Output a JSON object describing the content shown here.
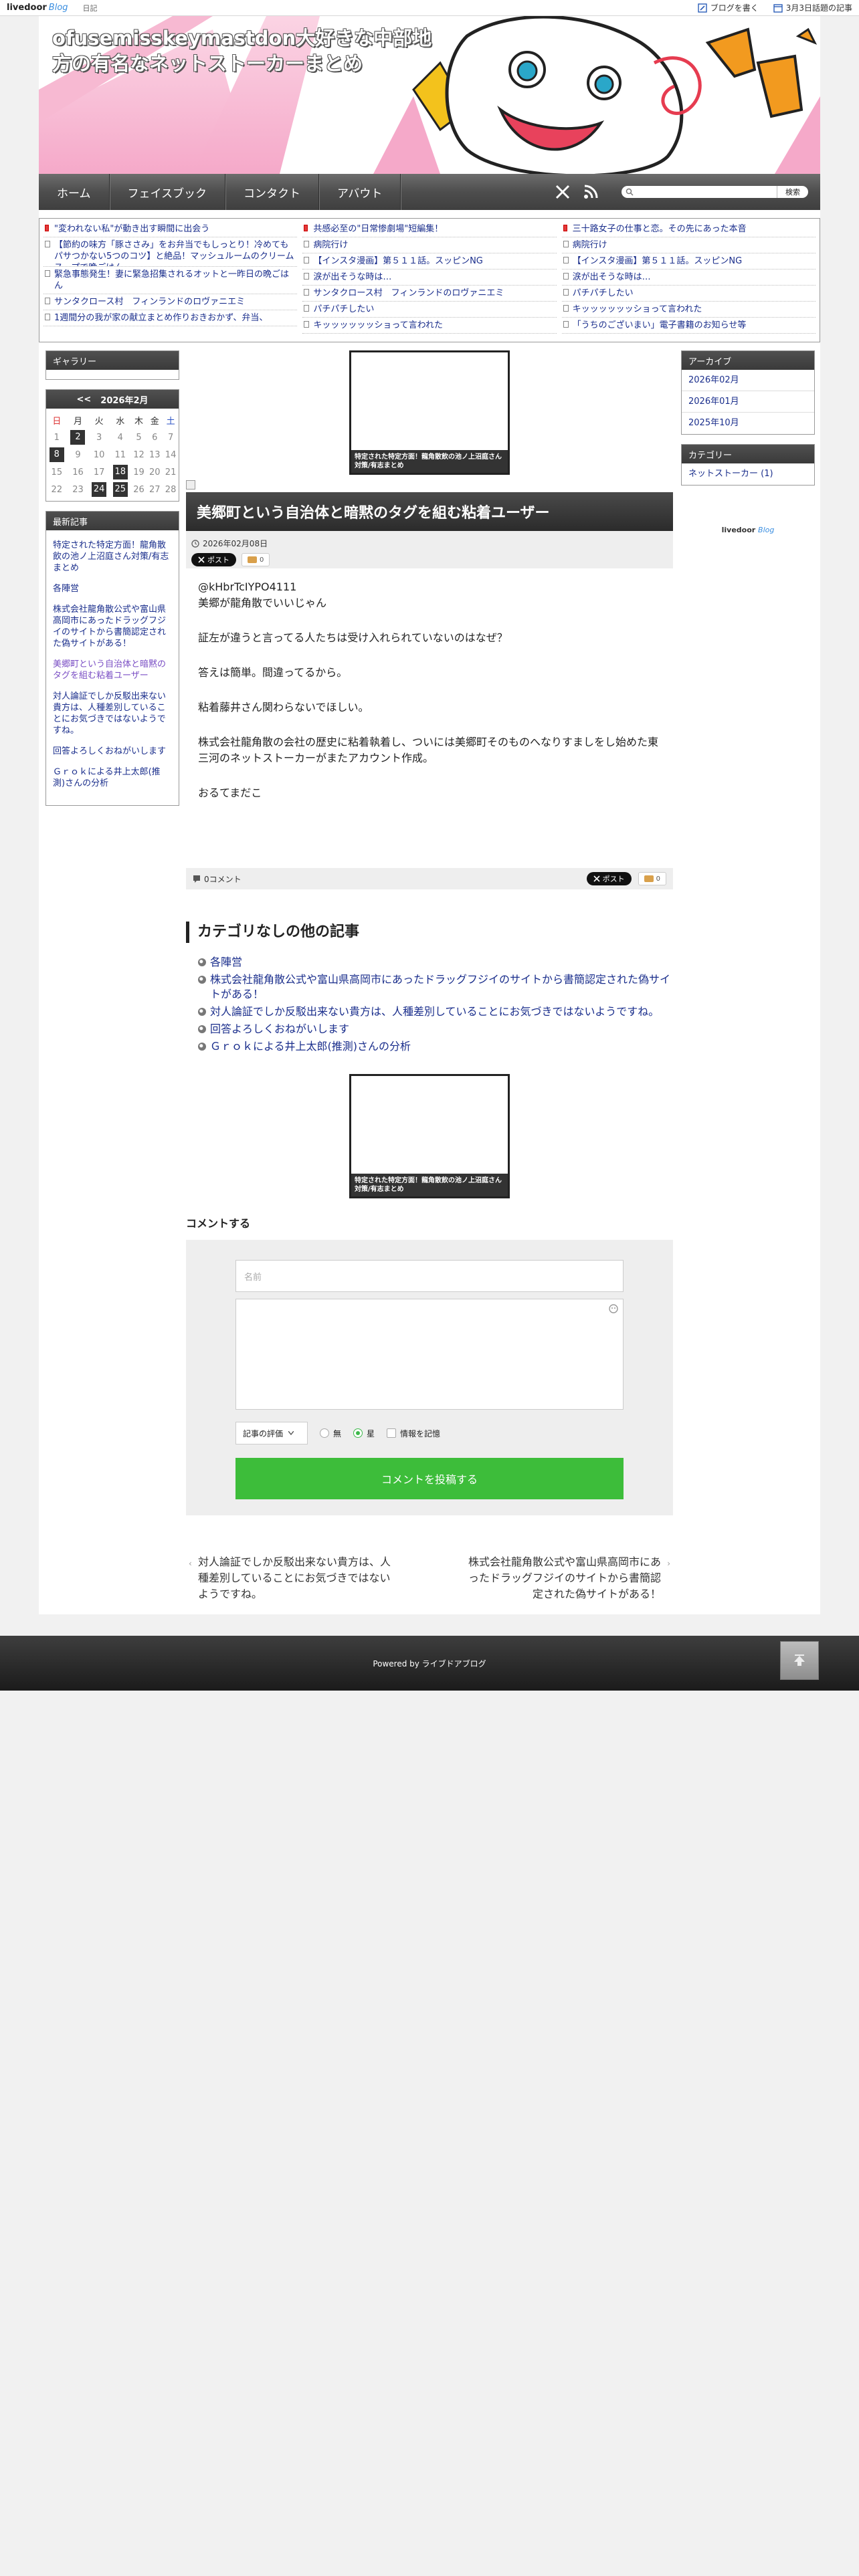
{
  "topbar": {
    "logo_main": "livedoor",
    "logo_sub": "Blog",
    "diary": "日記",
    "write_label": "ブログを書く",
    "popular_label": "3月3日話題の記事"
  },
  "header": {
    "title_line1": "ofusemisskeymastdon大好きな中部地",
    "title_line2": "方の有名なネットストーカーまとめ"
  },
  "nav": {
    "items": [
      "ホーム",
      "フェイスブック",
      "コンタクト",
      "アバウト"
    ],
    "search_button": "検索",
    "search_placeholder": ""
  },
  "ticker": {
    "col1": [
      "\"変われない私\"が動き出す瞬間に出会う",
      "【節約の味方「豚ささみ」をお弁当でもしっとり！冷めてもパサつかない5つのコツ】と絶品！マッシュルームのクリームスープで晩ごはん",
      "緊急事態発生！妻に緊急招集されるオットと一昨日の晩ごはん",
      "サンタクロース村　フィンランドのロヴァニエミ",
      "1週間分の我が家の献立まとめ作りおきおかず、弁当、"
    ],
    "col2": [
      "共感必至の\"日常惨劇場\"短編集！",
      "病院行け",
      "【インスタ漫画】第５１１話。スッピンNG",
      "涙が出そうな時は…",
      "サンタクロース村　フィンランドのロヴァニエミ",
      "パチパチしたい",
      "キッッッッッッショって言われた"
    ],
    "col3": [
      "三十路女子の仕事と恋。その先にあった本音",
      "病院行け",
      "【インスタ漫画】第５１１話。スッピンNG",
      "涙が出そうな時は…",
      "パチパチしたい",
      "キッッッッッッショって言われた",
      "「うちのございまい」電子書籍のお知らせ等"
    ]
  },
  "left": {
    "gallery_title": "ギャラリー",
    "cal_prev": "<<",
    "cal_title": "2026年2月",
    "weekdays": [
      "日",
      "月",
      "火",
      "水",
      "木",
      "金",
      "土"
    ],
    "weeks": [
      [
        "1",
        "2",
        "3",
        "4",
        "5",
        "6",
        "7"
      ],
      [
        "8",
        "9",
        "10",
        "11",
        "12",
        "13",
        "14"
      ],
      [
        "15",
        "16",
        "17",
        "18",
        "19",
        "20",
        "21"
      ],
      [
        "22",
        "23",
        "24",
        "25",
        "26",
        "27",
        "28"
      ]
    ],
    "recent_title": "最新記事",
    "recent": [
      "特定された特定方面！龍角散飲の池ノ上沼庭さん対策/有志まとめ",
      "各陣営",
      "株式会社龍角散公式や富山県高岡市にあったドラッグフジイのサイトから書簡認定された偽サイトがある！",
      "美郷町という自治体と暗黙のタグを組む粘着ユーザー",
      "対人論証でしか反駁出来ない貴方は、人種差別していることにお気づきではないようですね。",
      "回答よろしくおねがいします",
      "Ｇｒｏｋによる井上太郎(推測)さんの分析"
    ]
  },
  "main": {
    "ad_caption": "特定された特定方面！龍角散飲の池ノ上沼庭さん対策/有志まとめ",
    "title": "美郷町という自治体と暗黙のタグを組む粘着ユーザー",
    "date": "2026年02月08日",
    "x_post": "ポスト",
    "hatena_count": "0",
    "body": [
      "@kHbrTcIYPO4111",
      "美郷が龍角散でいいじゃん",
      "証左が違うと言ってる人たちは受け入れられていないのはなぜ？",
      "答えは簡単。間違ってるから。",
      "粘着藤井さん関わらないでほしい。",
      "株式会社龍角散の会社の歴史に粘着執着し、ついには美郷町そのものへなりすましをし始めた東三河のネットストーカーがまたアカウント作成。",
      "おるてまだこ"
    ],
    "comment_count": "0コメント",
    "related_title": "カテゴリなしの他の記事",
    "related": [
      "各陣営",
      "株式会社龍角散公式や富山県高岡市にあったドラッグフジイのサイトから書簡認定された偽サイトがある！",
      "対人論証でしか反駁出来ない貴方は、人種差別していることにお気づきではないようですね。",
      "回答よろしくおねがいします",
      "Ｇｒｏｋによる井上太郎(推測)さんの分析"
    ],
    "comment_title": "コメントする",
    "name_placeholder": "名前",
    "rating_label": "記事の評価",
    "rating_opts": [
      "無",
      "星",
      "情報を記憶"
    ],
    "submit": "コメントを投稿する",
    "prev_link": "対人論証でしか反駁出来ない貴方は、人種差別していることにお気づきではないようですね。",
    "next_link": "株式会社龍角散公式や富山県高岡市にあったドラッグフジイのサイトから書簡認定された偽サイトがある！"
  },
  "right": {
    "archive_title": "アーカイブ",
    "archives": [
      "2026年02月",
      "2026年01月",
      "2025年10月"
    ],
    "category_title": "カテゴリー",
    "categories": [
      "ネットストーカー (1)"
    ],
    "badge_main": "livedoor",
    "badge_sub": "Blog"
  },
  "footer": {
    "powered": "Powered by ライブドアブログ"
  },
  "colors": {
    "accent_green": "#3dbd3a",
    "header_pink": "#f5a9c9",
    "link": "#1a2e8c"
  }
}
